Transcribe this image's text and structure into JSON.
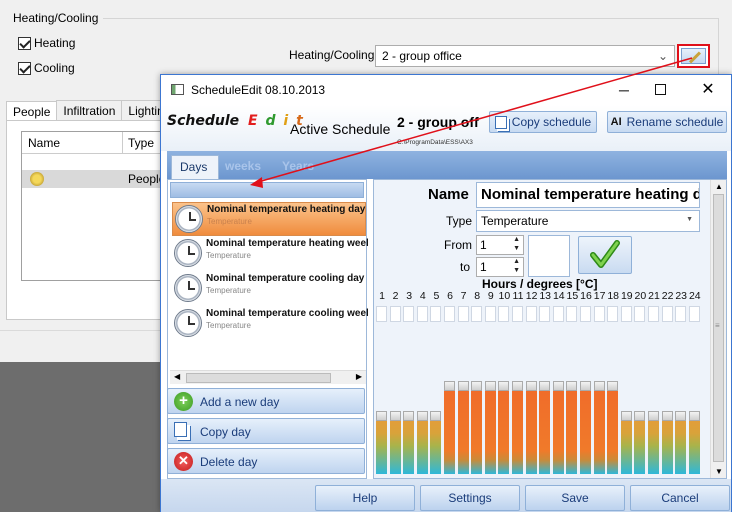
{
  "background": {
    "group_title": "Heating/Cooling",
    "checkbox_heating": "Heating",
    "checkbox_cooling": "Cooling",
    "combo_label": "Heating/Cooling",
    "combo_value": "2  - group office",
    "tabs": [
      "People",
      "Infiltration",
      "Lighting"
    ],
    "grid_headers": [
      "Name",
      "Type"
    ],
    "grid_row_type": "People"
  },
  "dialog": {
    "title": "ScheduleEdit 08.10.2013",
    "logo_word1": "Schedule",
    "logo_word2": [
      "E",
      "d",
      "i",
      "t"
    ],
    "active_schedule_label": "Active Schedule",
    "active_schedule_value": "2  - group off",
    "path": "C:\\ProgramData\\ESS\\AX3",
    "copy_schedule": "Copy schedule",
    "rename_schedule": "Rename schedule",
    "tabs": [
      "Days",
      "weeks",
      "Years"
    ],
    "list": [
      {
        "title": "Nominal temperature heating day",
        "subtitle": "Temperature"
      },
      {
        "title": "Nominal temperature heating week",
        "subtitle": "Temperature"
      },
      {
        "title": "Nominal temperature cooling day",
        "subtitle": "Temperature"
      },
      {
        "title": "Nominal temperature cooling week",
        "subtitle": "Temperature"
      }
    ],
    "add_day": "Add a new day",
    "copy_day": "Copy day",
    "delete_day": "Delete day",
    "name_label": "Name",
    "name_value": "Nominal temperature heating day",
    "type_label": "Type",
    "type_value": "Temperature",
    "from_label": "From",
    "from_value": "1",
    "to_label": "to",
    "to_value": "1",
    "hours_title": "Hours / degrees [°C]",
    "hours": [
      "1",
      "2",
      "3",
      "4",
      "5",
      "6",
      "7",
      "8",
      "9",
      "10",
      "11",
      "12",
      "13",
      "14",
      "15",
      "16",
      "17",
      "18",
      "19",
      "20",
      "21",
      "22",
      "23",
      "24"
    ],
    "hour_levels": [
      0.42,
      0.42,
      0.42,
      0.42,
      0.42,
      0.62,
      0.62,
      0.62,
      0.62,
      0.62,
      0.62,
      0.62,
      0.62,
      0.62,
      0.62,
      0.62,
      0.62,
      0.62,
      0.42,
      0.42,
      0.42,
      0.42,
      0.42,
      0.42
    ],
    "buttons": {
      "help": "Help",
      "settings": "Settings",
      "save": "Save",
      "cancel": "Cancel"
    },
    "colors": {
      "accent": "#3c76d1",
      "selected": "#f79b4b",
      "bar_high": "#f06a2a",
      "bar_low": "#2fb8d8",
      "ok_check": "#5ab52c"
    }
  },
  "icons": [
    "edit-pencil-icon",
    "minimize-icon",
    "maximize-icon",
    "close-icon",
    "clock-icon",
    "add-icon",
    "copy-icon",
    "delete-icon",
    "ok-check-icon",
    "people-icon"
  ]
}
